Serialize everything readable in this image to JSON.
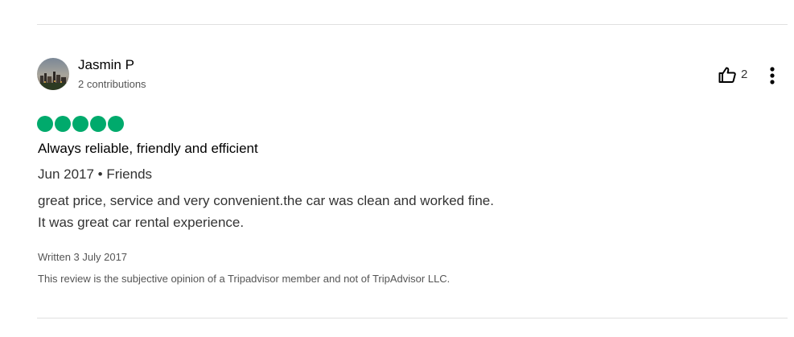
{
  "review": {
    "user": {
      "name": "Jasmin P",
      "contributions": "2 contributions",
      "avatar_icon": "avatar-city-photo"
    },
    "helpful_count": "2",
    "helpful_icon": "thumbs-up-icon",
    "more_icon": "vertical-ellipsis-icon",
    "rating": 5,
    "rating_max": 5,
    "rating_color": "#00aa6c",
    "title": "Always reliable, friendly and efficient",
    "trip_meta": "Jun 2017 • Friends",
    "body_lines": [
      "great price, service and very convenient.the car was clean and worked fine.",
      "It was great car rental experience."
    ],
    "written_date": "Written 3 July 2017",
    "disclaimer": "This review is the subjective opinion of a Tripadvisor member and not of TripAdvisor LLC."
  }
}
